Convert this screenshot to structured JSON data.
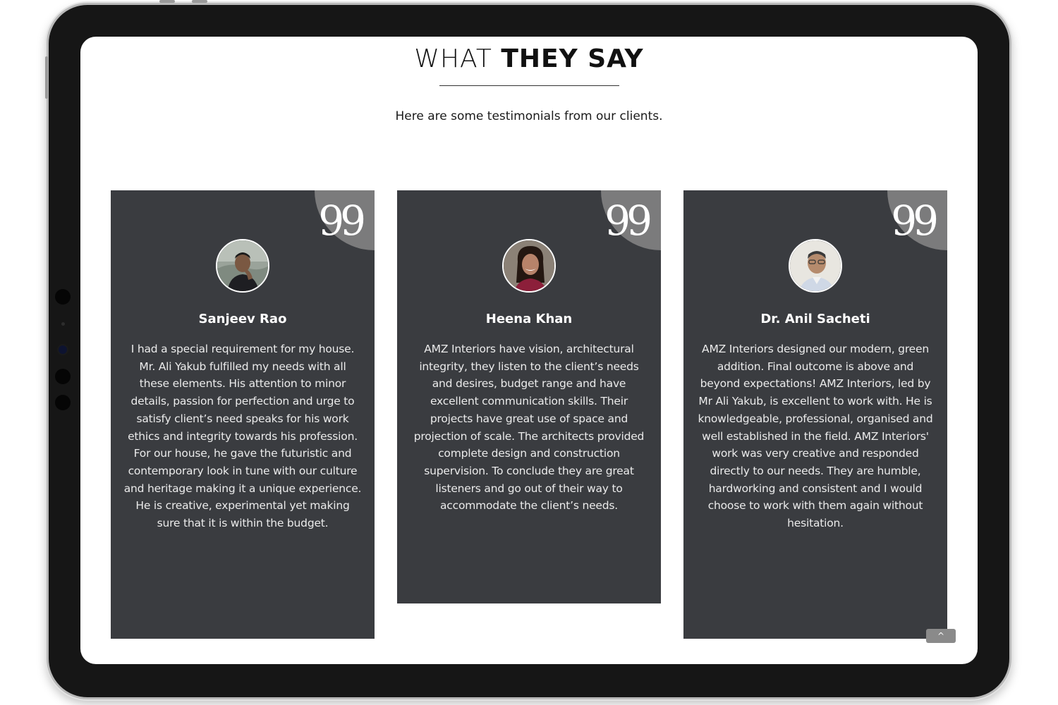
{
  "section": {
    "title_light": "WHAT ",
    "title_bold": "THEY SAY",
    "subtitle": "Here are some testimonials from our clients."
  },
  "testimonials": [
    {
      "name": "Sanjeev Rao",
      "text": "I had a special requirement for my house. Mr. Ali Yakub fulfilled my needs with all these elements. His attention to minor details, passion for perfection and urge to satisfy client’s need speaks for his work ethics and integrity towards his profession. For our house, he gave the futuristic and contemporary look in tune with our culture and heritage making it a unique experience. He is creative, experimental yet making sure that it is within the budget.",
      "quote_glyph": "99"
    },
    {
      "name": "Heena Khan",
      "text": "AMZ Interiors have vision, architectural integrity, they listen to the client’s needs and desires, budget range and have excellent communication skills. Their projects have great use of space and projection of scale. The architects provided complete design and construction supervision. To conclude they are great listeners and go out of their way to accommodate the client’s needs.",
      "quote_glyph": "99"
    },
    {
      "name": "Dr. Anil Sacheti",
      "text": "AMZ Interiors designed our modern, green addition. Final outcome is above and beyond expectations! AMZ Interiors, led by Mr Ali Yakub, is excellent to work with. He is knowledgeable, professional, organised and well established in the field. AMZ Interiors' work was very creative and responded directly to our needs. They are humble, hardworking and consistent and I would choose to work with them again without hesitation.",
      "quote_glyph": "99"
    }
  ],
  "scroll_top": {
    "icon": "chevron-up-icon",
    "glyph": "^"
  },
  "colors": {
    "card_bg": "#3a3c40",
    "quote_corner": "#7b7b7c",
    "text_light": "#ebebeb",
    "heading": "#111111"
  }
}
